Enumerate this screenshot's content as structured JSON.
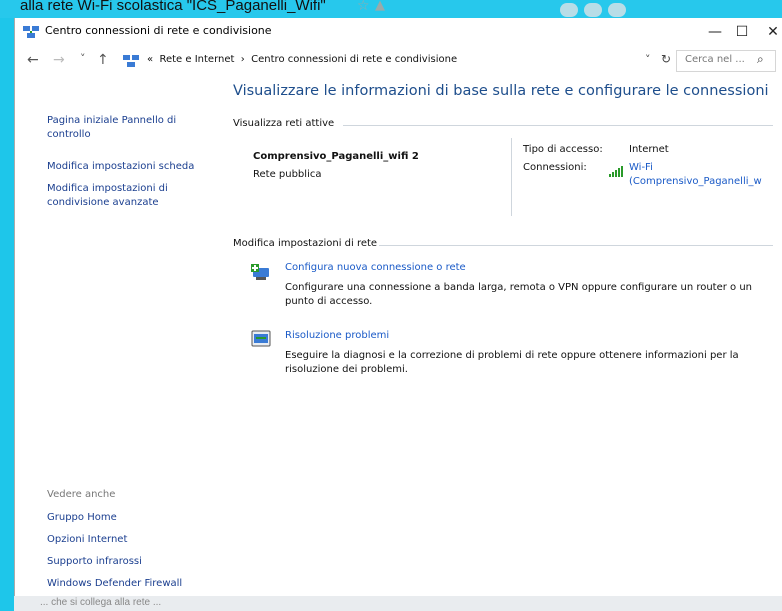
{
  "background": {
    "caption": "alla rete Wi-Fi scolastica \"ICS_Paganelli_Wifi\"",
    "bottom_text": "... che si collega alla rete ..."
  },
  "window": {
    "title": "Centro connessioni di rete e condivisione",
    "controls": {
      "minimize": "—",
      "maximize": "☐",
      "close": "✕"
    }
  },
  "address": {
    "back": "←",
    "forward": "→",
    "recent": "˅",
    "up": "↑",
    "overflow": "«",
    "crumb1": "Rete e Internet",
    "sep": "›",
    "crumb2": "Centro connessioni di rete e condivisione",
    "dropdown": "˅",
    "refresh": "↻",
    "search_placeholder": "Cerca nel ...",
    "search_icon": "⌕"
  },
  "sidebar": {
    "home_link": "Pagina iniziale Pannello di controllo",
    "links": [
      "Modifica impostazioni scheda",
      "Modifica impostazioni di condivisione avanzate"
    ],
    "see_also_label": "Vedere anche",
    "see_also": [
      "Gruppo Home",
      "Opzioni Internet",
      "Supporto infrarossi",
      "Windows Defender Firewall"
    ]
  },
  "main": {
    "heading": "Visualizzare le informazioni di base sulla rete e configurare le connessioni",
    "active_label": "Visualizza reti attive",
    "network_name": "Comprensivo_Paganelli_wifi  2",
    "network_type": "Rete pubblica",
    "access_label": "Tipo di accesso:",
    "access_value": "Internet",
    "conn_label": "Connessioni:",
    "conn_value_1": "Wi-Fi",
    "conn_value_2": "(Comprensivo_Paganelli_w",
    "settings_label": "Modifica impostazioni di rete",
    "items": [
      {
        "title": "Configura nuova connessione o rete",
        "desc": "Configurare una connessione a banda larga, remota o VPN oppure configurare un router o un punto di accesso."
      },
      {
        "title": "Risoluzione problemi",
        "desc": "Eseguire la diagnosi e la correzione di problemi di rete oppure ottenere informazioni per la risoluzione dei problemi."
      }
    ]
  },
  "colors": {
    "accent_link": "#1a5ac7",
    "heading": "#1e4e8c",
    "desktop": "#1ec6ea",
    "wifi_green": "#2a9a2a"
  }
}
